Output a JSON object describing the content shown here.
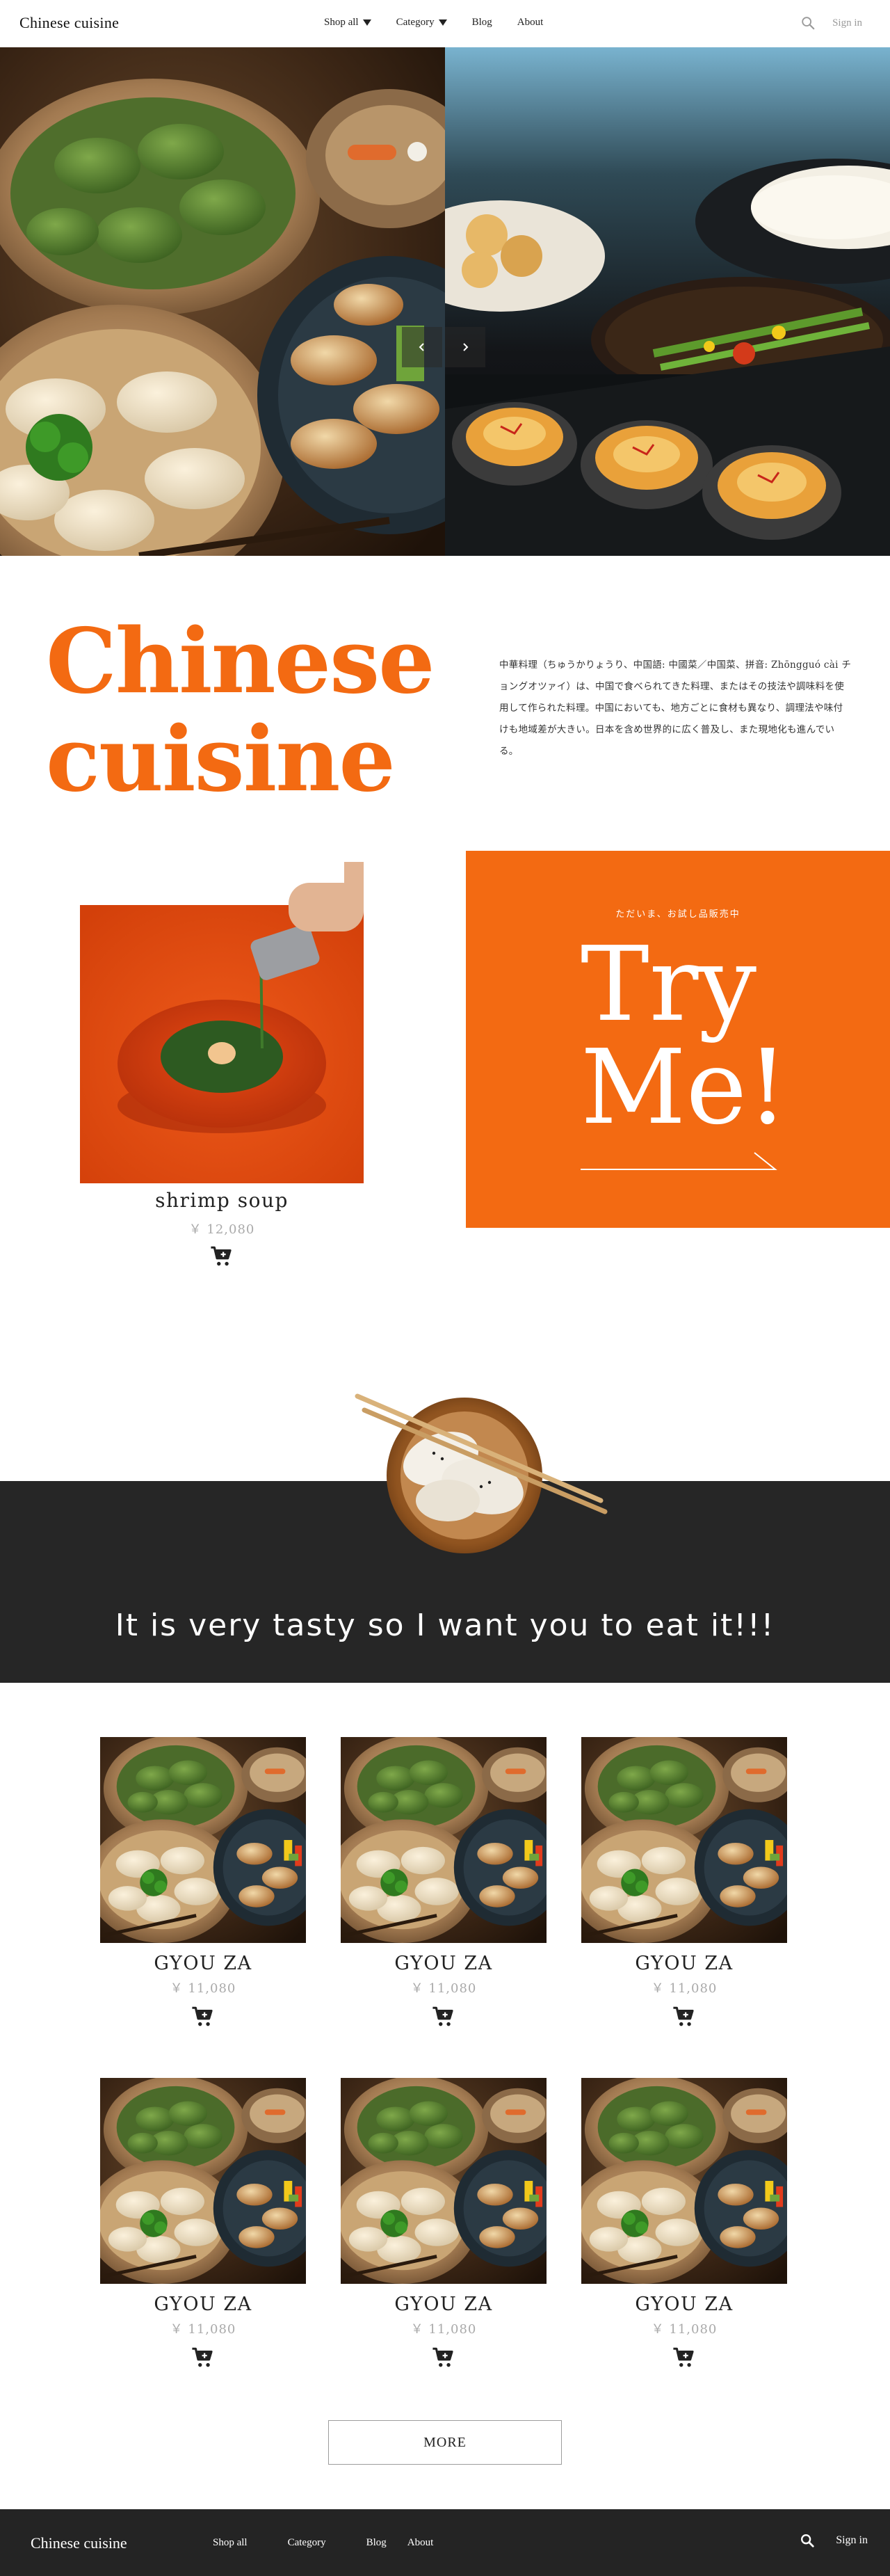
{
  "header": {
    "logo": "Chinese cuisine",
    "nav": [
      {
        "label": "Shop all"
      },
      {
        "label": "Category"
      },
      {
        "label": "Blog"
      },
      {
        "label": "About"
      }
    ],
    "signin": "Sign in"
  },
  "intro": {
    "title_line1": "Chinese",
    "title_line2": "cuisine",
    "description": "中華料理（ちゅうかりょうり、中国語: 中國菜／中国菜、拼音: Zhōngguó cài チョングオツァイ）は、中国で食べられてきた料理、またはその技法や調味料を使用して作られた料理。中国においても、地方ごとに食材も異なり、調理法や味付けも地域差が大きい。日本を含め世界的に広く普及し、また現地化も進んでいる。"
  },
  "feature": {
    "name": "shrimp soup",
    "price": "￥ 12,080"
  },
  "tryme": {
    "subtitle": "ただいま、お試し品販売中",
    "line1": "Try",
    "line2": "Me!"
  },
  "banner": {
    "text": "It is very tasty so I want you to eat it!!!"
  },
  "products": [
    {
      "name": "GYOU ZA",
      "price": "￥ 11,080"
    },
    {
      "name": "GYOU ZA",
      "price": "￥ 11,080"
    },
    {
      "name": "GYOU ZA",
      "price": "￥ 11,080"
    },
    {
      "name": "GYOU ZA",
      "price": "￥ 11,080"
    },
    {
      "name": "GYOU ZA",
      "price": "￥ 11,080"
    },
    {
      "name": "GYOU ZA",
      "price": "￥ 11,080"
    }
  ],
  "more_label": "MORE",
  "footer": {
    "logo": "Chinese cuisine",
    "nav": [
      {
        "label": "Shop all"
      },
      {
        "label": "Category"
      },
      {
        "label": "Blog"
      },
      {
        "label": "About"
      }
    ],
    "signin": "Sign in"
  },
  "colors": {
    "accent": "#f36a12",
    "dark": "#262626"
  }
}
